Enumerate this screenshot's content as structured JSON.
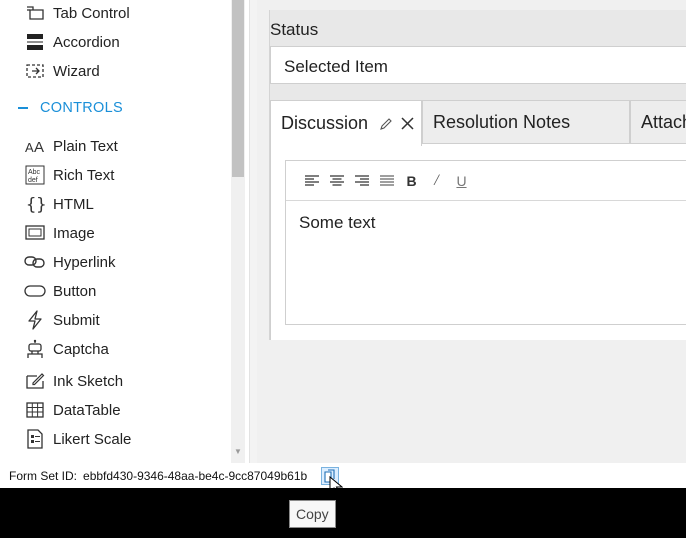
{
  "toolbox": {
    "layout_items": [
      {
        "label": "Tab Control",
        "icon": "tab-control-icon"
      },
      {
        "label": "Accordion",
        "icon": "accordion-icon"
      },
      {
        "label": "Wizard",
        "icon": "wizard-icon"
      }
    ],
    "section_label": "CONTROLS",
    "control_items": [
      {
        "label": "Plain Text",
        "icon": "plain-text-icon"
      },
      {
        "label": "Rich Text",
        "icon": "rich-text-icon"
      },
      {
        "label": "HTML",
        "icon": "html-icon"
      },
      {
        "label": "Image",
        "icon": "image-icon"
      },
      {
        "label": "Hyperlink",
        "icon": "hyperlink-icon"
      },
      {
        "label": "Button",
        "icon": "button-icon"
      },
      {
        "label": "Submit",
        "icon": "submit-icon"
      },
      {
        "label": "Captcha",
        "icon": "captcha-icon"
      },
      {
        "label": "Ink Sketch",
        "icon": "ink-sketch-icon"
      },
      {
        "label": "DataTable",
        "icon": "datatable-icon"
      },
      {
        "label": "Likert Scale",
        "icon": "likert-scale-icon"
      }
    ],
    "accent_color": "#1a8fd8"
  },
  "form": {
    "status_label": "Status",
    "status_value": "Selected Item",
    "tabs": [
      {
        "label": "Discussion"
      },
      {
        "label": "Resolution Notes"
      },
      {
        "label": "Attach"
      }
    ],
    "editor": {
      "toolbar": [
        "align-left-icon",
        "align-center-icon",
        "align-right-icon",
        "align-justify-icon",
        "bold-icon",
        "italic-icon",
        "underline-icon"
      ],
      "bold_label": "B",
      "italic_label": "/",
      "underline_label": "U",
      "content": "Some text"
    }
  },
  "footer": {
    "form_set_label": "Form Set ID:",
    "form_set_id": "ebbfd430-9346-48aa-be4c-9cc87049b61b",
    "copy_icon": "copy-icon",
    "tooltip": "Copy"
  }
}
